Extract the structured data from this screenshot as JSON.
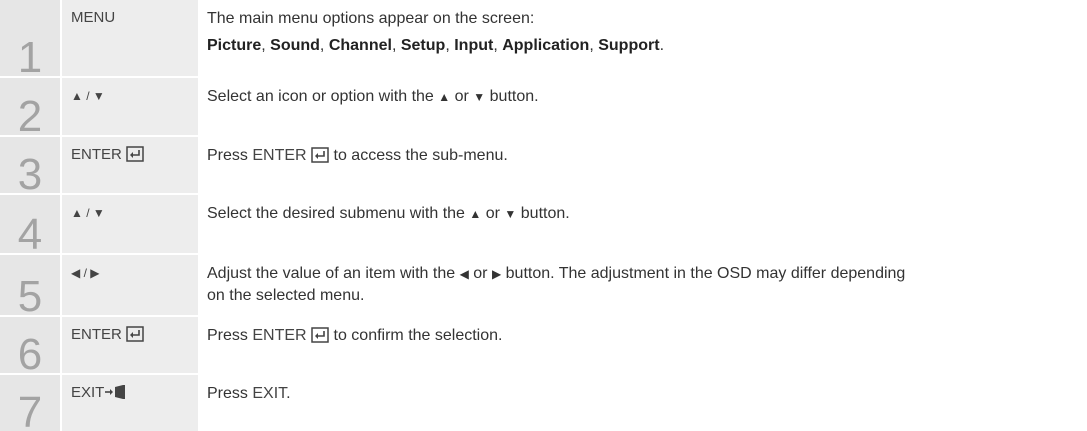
{
  "steps": [
    {
      "num": "1",
      "key": "MENU",
      "desc": "The main menu options appear on the screen:",
      "menu_items": [
        "Picture",
        "Sound",
        "Channel",
        "Setup",
        "Input",
        "Application",
        "Support"
      ]
    },
    {
      "num": "2",
      "key": "▲ / ▼",
      "desc_a": "Select an icon or option with the",
      "desc_b": "or",
      "desc_c": "button."
    },
    {
      "num": "3",
      "key": "ENTER",
      "desc_a": "Press",
      "desc_key": "ENTER",
      "desc_c": "to access the sub-menu."
    },
    {
      "num": "4",
      "key": "▲ / ▼",
      "desc_a": "Select the desired submenu with the",
      "desc_b": "or",
      "desc_c": "button."
    },
    {
      "num": "5",
      "key": "◀ / ▶",
      "desc_a": "Adjust the value of an item with the",
      "desc_b": "or",
      "desc_c": "button. The adjustment in the OSD may differ depending",
      "desc_d": "on the selected menu."
    },
    {
      "num": "6",
      "key": "ENTER",
      "desc_a": "Press",
      "desc_key": "ENTER",
      "desc_c": "to confirm the selection."
    },
    {
      "num": "7",
      "key": "EXIT",
      "desc_a": "Press",
      "desc_key": "EXIT",
      "desc_c": "."
    }
  ],
  "symbols": {
    "up": "▲",
    "down": "▼",
    "left": "◀",
    "right": "▶",
    "sep": ",",
    "end": "."
  }
}
